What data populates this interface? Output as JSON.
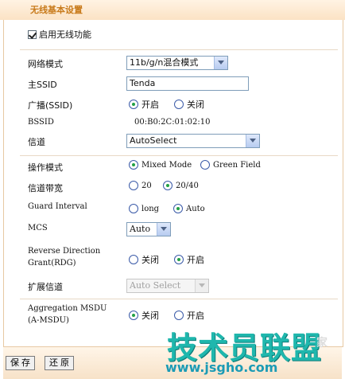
{
  "header": {
    "title": "无线基本设置"
  },
  "enable_wireless": {
    "label": "启用无线功能",
    "checked": true
  },
  "network_mode": {
    "label": "网络模式",
    "value": "11b/g/n混合模式"
  },
  "ssid": {
    "label": "主SSID",
    "value": "Tenda"
  },
  "broadcast": {
    "label": "广播(SSID)",
    "options": [
      "开启",
      "关闭"
    ],
    "selected": "开启"
  },
  "bssid": {
    "label": "BSSID",
    "value": "00:B0:2C:01:02:10"
  },
  "channel": {
    "label": "信道",
    "value": "AutoSelect"
  },
  "operation_mode": {
    "label": "操作模式",
    "options": [
      "Mixed Mode",
      "Green Field"
    ],
    "selected": "Mixed Mode"
  },
  "bandwidth": {
    "label": "信道带宽",
    "options": [
      "20",
      "20/40"
    ],
    "selected": "20/40"
  },
  "guard_interval": {
    "label": "Guard Interval",
    "options": [
      "long",
      "Auto"
    ],
    "selected": "Auto"
  },
  "mcs": {
    "label": "MCS",
    "value": "Auto"
  },
  "rdg": {
    "label_line1": "Reverse Direction",
    "label_line2": "Grant(RDG)",
    "options": [
      "关闭",
      "开启"
    ],
    "selected": "开启"
  },
  "ext_channel": {
    "label": "扩展信道",
    "value": "Auto Select"
  },
  "amsdu": {
    "label_line1": "Aggregation MSDU",
    "label_line2": "(A-MSDU)",
    "options": [
      "关闭",
      "开启"
    ],
    "selected": "关闭"
  },
  "buttons": {
    "save": "保 存",
    "restore": "还 原"
  },
  "watermark": {
    "logo": "技术员联盟",
    "url": "www.jsgho.com",
    "ext": "家"
  }
}
